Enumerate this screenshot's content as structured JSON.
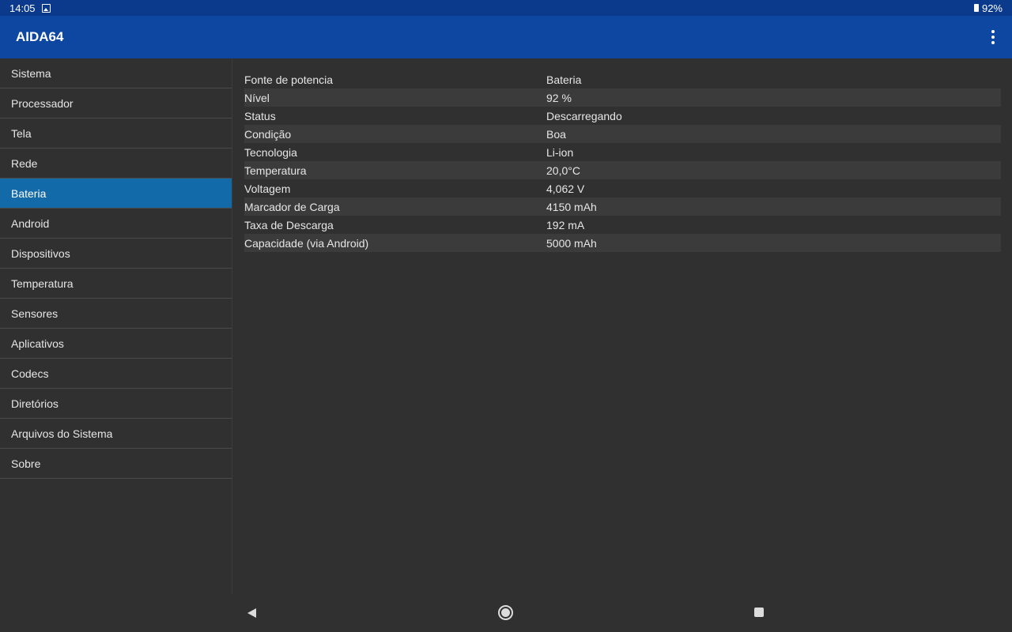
{
  "status_bar": {
    "time": "14:05",
    "battery_percent": "92%",
    "icons": [
      "image-icon",
      "battery-icon"
    ]
  },
  "app_bar": {
    "title": "AIDA64",
    "menu_icon": "more-vert-icon"
  },
  "sidebar": {
    "selected": "Bateria",
    "items": [
      {
        "label": "Sistema"
      },
      {
        "label": "Processador"
      },
      {
        "label": "Tela"
      },
      {
        "label": "Rede"
      },
      {
        "label": "Bateria"
      },
      {
        "label": "Android"
      },
      {
        "label": "Dispositivos"
      },
      {
        "label": "Temperatura"
      },
      {
        "label": "Sensores"
      },
      {
        "label": "Aplicativos"
      },
      {
        "label": "Codecs"
      },
      {
        "label": "Diretórios"
      },
      {
        "label": "Arquivos do Sistema"
      },
      {
        "label": "Sobre"
      }
    ]
  },
  "battery_info": {
    "rows": [
      {
        "key": "Fonte de potencia",
        "value": "Bateria"
      },
      {
        "key": "Nível",
        "value": "92 %"
      },
      {
        "key": "Status",
        "value": "Descarregando"
      },
      {
        "key": "Condição",
        "value": "Boa"
      },
      {
        "key": "Tecnologia",
        "value": "Li-ion"
      },
      {
        "key": "Temperatura",
        "value": "20,0°C"
      },
      {
        "key": "Voltagem",
        "value": "4,062 V"
      },
      {
        "key": "Marcador de Carga",
        "value": "4150 mAh"
      },
      {
        "key": "Taxa de Descarga",
        "value": "192 mA"
      },
      {
        "key": "Capacidade (via Android)",
        "value": "5000 mAh"
      }
    ]
  },
  "nav_bar": {
    "icons": [
      "back-icon",
      "home-icon",
      "recents-icon"
    ]
  },
  "colors": {
    "status_bar": "#0b3a8c",
    "app_bar": "#0d47a1",
    "selected_item": "#136aa8",
    "background": "#303030",
    "alt_row": "#3b3b3b"
  }
}
